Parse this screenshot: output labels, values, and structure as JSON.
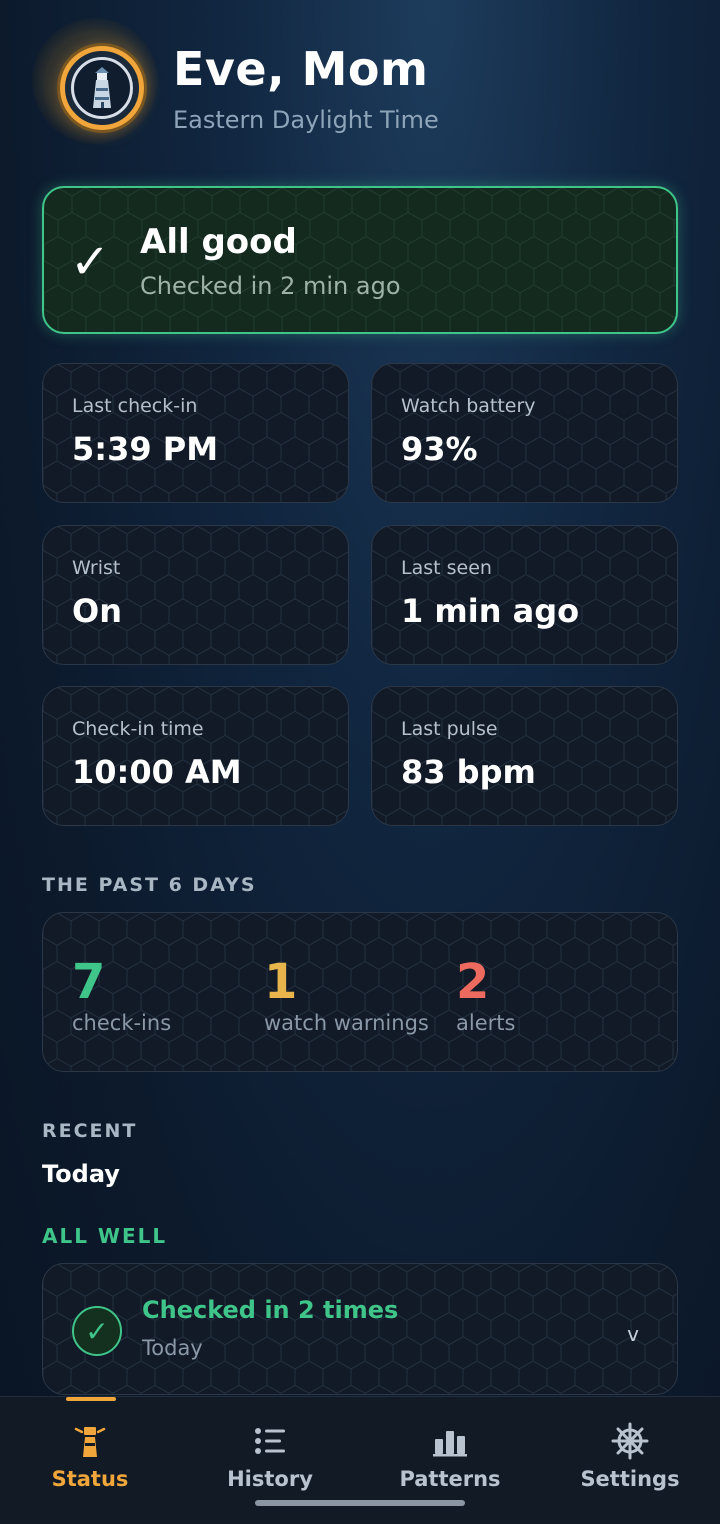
{
  "header": {
    "name": "Eve, Mom",
    "timezone": "Eastern Daylight Time",
    "avatar_icon": "lighthouse-icon"
  },
  "status": {
    "title": "All good",
    "subtitle": "Checked in 2 min ago",
    "icon": "checkmark-icon",
    "color": "#3fc489"
  },
  "metrics": [
    {
      "label": "Last check-in",
      "value": "5:39 PM"
    },
    {
      "label": "Watch battery",
      "value": "93%"
    },
    {
      "label": "Wrist",
      "value": "On"
    },
    {
      "label": "Last seen",
      "value": "1 min ago"
    },
    {
      "label": "Check-in time",
      "value": "10:00 AM"
    },
    {
      "label": "Last pulse",
      "value": "83 bpm"
    }
  ],
  "summary": {
    "heading": "THE PAST 6 DAYS",
    "items": [
      {
        "value": "7",
        "caption": "check-ins",
        "color": "#3fc489"
      },
      {
        "value": "1",
        "caption": "watch warnings",
        "color": "#e8b44c"
      },
      {
        "value": "2",
        "caption": "alerts",
        "color": "#ec6a5e"
      }
    ]
  },
  "recent": {
    "heading": "RECENT",
    "day": "Today",
    "group_label": "ALL WELL",
    "entry": {
      "title": "Checked in 2 times",
      "subtitle": "Today",
      "chevron": "v"
    }
  },
  "tabs": [
    {
      "label": "Status",
      "icon": "lighthouse-icon",
      "active": true
    },
    {
      "label": "History",
      "icon": "list-icon",
      "active": false
    },
    {
      "label": "Patterns",
      "icon": "bar-chart-icon",
      "active": false
    },
    {
      "label": "Settings",
      "icon": "helm-icon",
      "active": false
    }
  ],
  "colors": {
    "accent": "#f0a63a",
    "good": "#3fc489",
    "warning": "#e8b44c",
    "alert": "#ec6a5e"
  }
}
